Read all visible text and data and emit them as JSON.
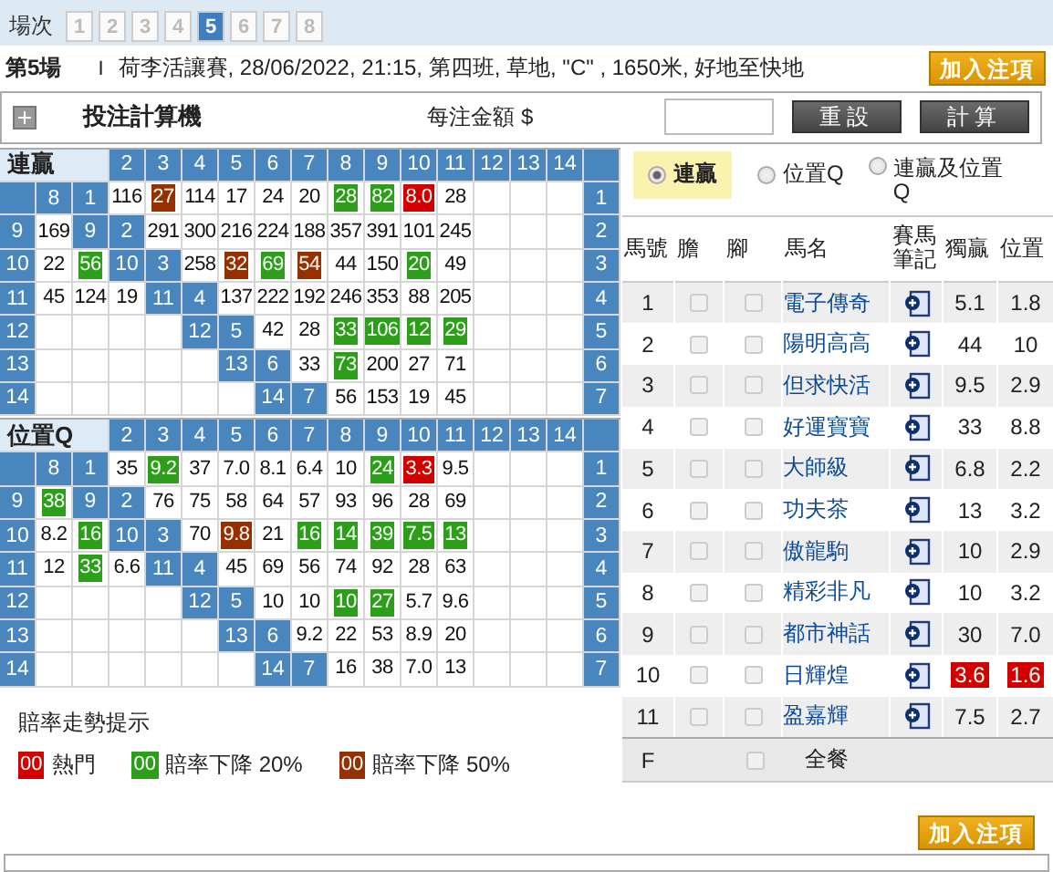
{
  "race_selector": {
    "label": "場次",
    "races": [
      {
        "label": "1",
        "selected": false
      },
      {
        "label": "2",
        "selected": false
      },
      {
        "label": "3",
        "selected": false
      },
      {
        "label": "4",
        "selected": false
      },
      {
        "label": "5",
        "selected": true
      },
      {
        "label": "6",
        "selected": false
      },
      {
        "label": "7",
        "selected": false
      },
      {
        "label": "8",
        "selected": false
      }
    ]
  },
  "race_header": {
    "number": "第5場",
    "separator": "I",
    "info": "荷李活讓賽, 28/06/2022, 21:15, 第四班, 草地, \"C\" , 1650米, 好地至快地",
    "add_button": "加入注項"
  },
  "calculator": {
    "title": "投注計算機",
    "amount_label": "每注金額 $",
    "buttons": [
      "重設",
      "計算"
    ]
  },
  "grids": [
    {
      "title": "連贏",
      "header": [
        "2",
        "3",
        "4",
        "5",
        "6",
        "7",
        "8",
        "9",
        "10",
        "11",
        "12",
        "13",
        "14"
      ],
      "rows": [
        [
          {
            "kind": "label"
          },
          {
            "kind": "label",
            "text": "8"
          },
          {
            "kind": "label",
            "text": "1"
          },
          {
            "kind": "odds",
            "text": "116"
          },
          {
            "kind": "drop50",
            "text": "27"
          },
          {
            "kind": "odds",
            "text": "114"
          },
          {
            "kind": "odds",
            "text": "17"
          },
          {
            "kind": "odds",
            "text": "24"
          },
          {
            "kind": "odds",
            "text": "20"
          },
          {
            "kind": "drop20",
            "text": "28"
          },
          {
            "kind": "drop20",
            "text": "82"
          },
          {
            "kind": "hot",
            "text": "8.0"
          },
          {
            "kind": "odds",
            "text": "28"
          },
          {
            "kind": "empty"
          },
          {
            "kind": "empty"
          },
          {
            "kind": "empty"
          },
          {
            "kind": "label",
            "text": "1"
          }
        ],
        [
          {
            "kind": "label",
            "text": "9"
          },
          {
            "kind": "odds",
            "text": "169"
          },
          {
            "kind": "label",
            "text": "9"
          },
          {
            "kind": "label",
            "text": "2"
          },
          {
            "kind": "odds",
            "text": "291"
          },
          {
            "kind": "odds",
            "text": "300"
          },
          {
            "kind": "odds",
            "text": "216"
          },
          {
            "kind": "odds",
            "text": "224"
          },
          {
            "kind": "odds",
            "text": "188"
          },
          {
            "kind": "odds",
            "text": "357"
          },
          {
            "kind": "odds",
            "text": "391"
          },
          {
            "kind": "odds",
            "text": "101"
          },
          {
            "kind": "odds",
            "text": "245"
          },
          {
            "kind": "empty"
          },
          {
            "kind": "empty"
          },
          {
            "kind": "empty"
          },
          {
            "kind": "label",
            "text": "2"
          }
        ],
        [
          {
            "kind": "label",
            "text": "10"
          },
          {
            "kind": "odds",
            "text": "22"
          },
          {
            "kind": "drop20",
            "text": "56"
          },
          {
            "kind": "label",
            "text": "10"
          },
          {
            "kind": "label",
            "text": "3"
          },
          {
            "kind": "odds",
            "text": "258"
          },
          {
            "kind": "drop50",
            "text": "32"
          },
          {
            "kind": "drop20",
            "text": "69"
          },
          {
            "kind": "drop50",
            "text": "54"
          },
          {
            "kind": "odds",
            "text": "44"
          },
          {
            "kind": "odds",
            "text": "150"
          },
          {
            "kind": "drop20",
            "text": "20"
          },
          {
            "kind": "odds",
            "text": "49"
          },
          {
            "kind": "empty"
          },
          {
            "kind": "empty"
          },
          {
            "kind": "empty"
          },
          {
            "kind": "label",
            "text": "3"
          }
        ],
        [
          {
            "kind": "label",
            "text": "11"
          },
          {
            "kind": "odds",
            "text": "45"
          },
          {
            "kind": "odds",
            "text": "124"
          },
          {
            "kind": "odds",
            "text": "19"
          },
          {
            "kind": "label",
            "text": "11"
          },
          {
            "kind": "label",
            "text": "4"
          },
          {
            "kind": "odds",
            "text": "137"
          },
          {
            "kind": "odds",
            "text": "222"
          },
          {
            "kind": "odds",
            "text": "192"
          },
          {
            "kind": "odds",
            "text": "246"
          },
          {
            "kind": "odds",
            "text": "353"
          },
          {
            "kind": "odds",
            "text": "88"
          },
          {
            "kind": "odds",
            "text": "205"
          },
          {
            "kind": "empty"
          },
          {
            "kind": "empty"
          },
          {
            "kind": "empty"
          },
          {
            "kind": "label",
            "text": "4"
          }
        ],
        [
          {
            "kind": "label",
            "text": "12"
          },
          {
            "kind": "empty"
          },
          {
            "kind": "empty"
          },
          {
            "kind": "empty"
          },
          {
            "kind": "empty"
          },
          {
            "kind": "label",
            "text": "12"
          },
          {
            "kind": "label",
            "text": "5"
          },
          {
            "kind": "odds",
            "text": "42"
          },
          {
            "kind": "odds",
            "text": "28"
          },
          {
            "kind": "drop20",
            "text": "33"
          },
          {
            "kind": "drop20",
            "text": "106"
          },
          {
            "kind": "drop20",
            "text": "12"
          },
          {
            "kind": "drop20",
            "text": "29"
          },
          {
            "kind": "empty"
          },
          {
            "kind": "empty"
          },
          {
            "kind": "empty"
          },
          {
            "kind": "label",
            "text": "5"
          }
        ],
        [
          {
            "kind": "label",
            "text": "13"
          },
          {
            "kind": "empty"
          },
          {
            "kind": "empty"
          },
          {
            "kind": "empty"
          },
          {
            "kind": "empty"
          },
          {
            "kind": "empty"
          },
          {
            "kind": "label",
            "text": "13"
          },
          {
            "kind": "label",
            "text": "6"
          },
          {
            "kind": "odds",
            "text": "33"
          },
          {
            "kind": "drop20",
            "text": "73"
          },
          {
            "kind": "odds",
            "text": "200"
          },
          {
            "kind": "odds",
            "text": "27"
          },
          {
            "kind": "odds",
            "text": "71"
          },
          {
            "kind": "empty"
          },
          {
            "kind": "empty"
          },
          {
            "kind": "empty"
          },
          {
            "kind": "label",
            "text": "6"
          }
        ],
        [
          {
            "kind": "label",
            "text": "14"
          },
          {
            "kind": "empty"
          },
          {
            "kind": "empty"
          },
          {
            "kind": "empty"
          },
          {
            "kind": "empty"
          },
          {
            "kind": "empty"
          },
          {
            "kind": "empty"
          },
          {
            "kind": "label",
            "text": "14"
          },
          {
            "kind": "label",
            "text": "7"
          },
          {
            "kind": "odds",
            "text": "56"
          },
          {
            "kind": "odds",
            "text": "153"
          },
          {
            "kind": "odds",
            "text": "19"
          },
          {
            "kind": "odds",
            "text": "45"
          },
          {
            "kind": "empty"
          },
          {
            "kind": "empty"
          },
          {
            "kind": "empty"
          },
          {
            "kind": "label",
            "text": "7"
          }
        ]
      ]
    },
    {
      "title": "位置Q",
      "header": [
        "2",
        "3",
        "4",
        "5",
        "6",
        "7",
        "8",
        "9",
        "10",
        "11",
        "12",
        "13",
        "14"
      ],
      "rows": [
        [
          {
            "kind": "label"
          },
          {
            "kind": "label",
            "text": "8"
          },
          {
            "kind": "label",
            "text": "1"
          },
          {
            "kind": "odds",
            "text": "35"
          },
          {
            "kind": "drop20",
            "text": "9.2"
          },
          {
            "kind": "odds",
            "text": "37"
          },
          {
            "kind": "odds",
            "text": "7.0"
          },
          {
            "kind": "odds",
            "text": "8.1"
          },
          {
            "kind": "odds",
            "text": "6.4"
          },
          {
            "kind": "odds",
            "text": "10"
          },
          {
            "kind": "drop20",
            "text": "24"
          },
          {
            "kind": "hot",
            "text": "3.3"
          },
          {
            "kind": "odds",
            "text": "9.5"
          },
          {
            "kind": "empty"
          },
          {
            "kind": "empty"
          },
          {
            "kind": "empty"
          },
          {
            "kind": "label",
            "text": "1"
          }
        ],
        [
          {
            "kind": "label",
            "text": "9"
          },
          {
            "kind": "drop20",
            "text": "38"
          },
          {
            "kind": "label",
            "text": "9"
          },
          {
            "kind": "label",
            "text": "2"
          },
          {
            "kind": "odds",
            "text": "76"
          },
          {
            "kind": "odds",
            "text": "75"
          },
          {
            "kind": "odds",
            "text": "58"
          },
          {
            "kind": "odds",
            "text": "64"
          },
          {
            "kind": "odds",
            "text": "57"
          },
          {
            "kind": "odds",
            "text": "93"
          },
          {
            "kind": "odds",
            "text": "96"
          },
          {
            "kind": "odds",
            "text": "28"
          },
          {
            "kind": "odds",
            "text": "69"
          },
          {
            "kind": "empty"
          },
          {
            "kind": "empty"
          },
          {
            "kind": "empty"
          },
          {
            "kind": "label",
            "text": "2"
          }
        ],
        [
          {
            "kind": "label",
            "text": "10"
          },
          {
            "kind": "odds",
            "text": "8.2"
          },
          {
            "kind": "drop20",
            "text": "16"
          },
          {
            "kind": "label",
            "text": "10"
          },
          {
            "kind": "label",
            "text": "3"
          },
          {
            "kind": "odds",
            "text": "70"
          },
          {
            "kind": "drop50",
            "text": "9.8"
          },
          {
            "kind": "odds",
            "text": "21"
          },
          {
            "kind": "drop20",
            "text": "16"
          },
          {
            "kind": "drop20",
            "text": "14"
          },
          {
            "kind": "drop20",
            "text": "39"
          },
          {
            "kind": "drop20",
            "text": "7.5"
          },
          {
            "kind": "drop20",
            "text": "13"
          },
          {
            "kind": "empty"
          },
          {
            "kind": "empty"
          },
          {
            "kind": "empty"
          },
          {
            "kind": "label",
            "text": "3"
          }
        ],
        [
          {
            "kind": "label",
            "text": "11"
          },
          {
            "kind": "odds",
            "text": "12"
          },
          {
            "kind": "drop20",
            "text": "33"
          },
          {
            "kind": "odds",
            "text": "6.6"
          },
          {
            "kind": "label",
            "text": "11"
          },
          {
            "kind": "label",
            "text": "4"
          },
          {
            "kind": "odds",
            "text": "45"
          },
          {
            "kind": "odds",
            "text": "69"
          },
          {
            "kind": "odds",
            "text": "56"
          },
          {
            "kind": "odds",
            "text": "74"
          },
          {
            "kind": "odds",
            "text": "92"
          },
          {
            "kind": "odds",
            "text": "28"
          },
          {
            "kind": "odds",
            "text": "63"
          },
          {
            "kind": "empty"
          },
          {
            "kind": "empty"
          },
          {
            "kind": "empty"
          },
          {
            "kind": "label",
            "text": "4"
          }
        ],
        [
          {
            "kind": "label",
            "text": "12"
          },
          {
            "kind": "empty"
          },
          {
            "kind": "empty"
          },
          {
            "kind": "empty"
          },
          {
            "kind": "empty"
          },
          {
            "kind": "label",
            "text": "12"
          },
          {
            "kind": "label",
            "text": "5"
          },
          {
            "kind": "odds",
            "text": "10"
          },
          {
            "kind": "odds",
            "text": "10"
          },
          {
            "kind": "drop20",
            "text": "10"
          },
          {
            "kind": "drop20",
            "text": "27"
          },
          {
            "kind": "odds",
            "text": "5.7"
          },
          {
            "kind": "odds",
            "text": "9.6"
          },
          {
            "kind": "empty"
          },
          {
            "kind": "empty"
          },
          {
            "kind": "empty"
          },
          {
            "kind": "label",
            "text": "5"
          }
        ],
        [
          {
            "kind": "label",
            "text": "13"
          },
          {
            "kind": "empty"
          },
          {
            "kind": "empty"
          },
          {
            "kind": "empty"
          },
          {
            "kind": "empty"
          },
          {
            "kind": "empty"
          },
          {
            "kind": "label",
            "text": "13"
          },
          {
            "kind": "label",
            "text": "6"
          },
          {
            "kind": "odds",
            "text": "9.2"
          },
          {
            "kind": "odds",
            "text": "22"
          },
          {
            "kind": "odds",
            "text": "53"
          },
          {
            "kind": "odds",
            "text": "8.9"
          },
          {
            "kind": "odds",
            "text": "20"
          },
          {
            "kind": "empty"
          },
          {
            "kind": "empty"
          },
          {
            "kind": "empty"
          },
          {
            "kind": "label",
            "text": "6"
          }
        ],
        [
          {
            "kind": "label",
            "text": "14"
          },
          {
            "kind": "empty"
          },
          {
            "kind": "empty"
          },
          {
            "kind": "empty"
          },
          {
            "kind": "empty"
          },
          {
            "kind": "empty"
          },
          {
            "kind": "empty"
          },
          {
            "kind": "label",
            "text": "14"
          },
          {
            "kind": "label",
            "text": "7"
          },
          {
            "kind": "odds",
            "text": "16"
          },
          {
            "kind": "odds",
            "text": "38"
          },
          {
            "kind": "odds",
            "text": "7.0"
          },
          {
            "kind": "odds",
            "text": "13"
          },
          {
            "kind": "empty"
          },
          {
            "kind": "empty"
          },
          {
            "kind": "empty"
          },
          {
            "kind": "label",
            "text": "7"
          }
        ]
      ]
    }
  ],
  "pool_options": [
    {
      "label": "連贏",
      "selected": true
    },
    {
      "label": "位置Q",
      "selected": false
    },
    {
      "label": "連贏及位置Q",
      "selected": false
    }
  ],
  "horse_table": {
    "columns": [
      "馬號",
      "膽",
      "腳",
      "馬名",
      "賽馬筆記",
      "獨贏",
      "位置"
    ],
    "rows": [
      {
        "number": "1",
        "banker": false,
        "leg": false,
        "name": "電子傳奇",
        "win": {
          "text": "5.1",
          "hot": false
        },
        "place": {
          "text": "1.8",
          "hot": false
        }
      },
      {
        "number": "2",
        "banker": false,
        "leg": false,
        "name": "陽明高高",
        "win": {
          "text": "44",
          "hot": false
        },
        "place": {
          "text": "10",
          "hot": false
        }
      },
      {
        "number": "3",
        "banker": false,
        "leg": false,
        "name": "但求快活",
        "win": {
          "text": "9.5",
          "hot": false
        },
        "place": {
          "text": "2.9",
          "hot": false
        }
      },
      {
        "number": "4",
        "banker": false,
        "leg": false,
        "name": "好運寶寶",
        "win": {
          "text": "33",
          "hot": false
        },
        "place": {
          "text": "8.8",
          "hot": false
        }
      },
      {
        "number": "5",
        "banker": false,
        "leg": false,
        "name": "大師級",
        "win": {
          "text": "6.8",
          "hot": false
        },
        "place": {
          "text": "2.2",
          "hot": false
        }
      },
      {
        "number": "6",
        "banker": false,
        "leg": false,
        "name": "功夫茶",
        "win": {
          "text": "13",
          "hot": false
        },
        "place": {
          "text": "3.2",
          "hot": false
        }
      },
      {
        "number": "7",
        "banker": false,
        "leg": false,
        "name": "傲龍駒",
        "win": {
          "text": "10",
          "hot": false
        },
        "place": {
          "text": "2.9",
          "hot": false
        }
      },
      {
        "number": "8",
        "banker": false,
        "leg": false,
        "name": "精彩非凡",
        "win": {
          "text": "10",
          "hot": false
        },
        "place": {
          "text": "3.2",
          "hot": false
        }
      },
      {
        "number": "9",
        "banker": false,
        "leg": false,
        "name": "都市神話",
        "win": {
          "text": "30",
          "hot": false
        },
        "place": {
          "text": "7.0",
          "hot": false
        }
      },
      {
        "number": "10",
        "banker": false,
        "leg": false,
        "name": "日輝煌",
        "win": {
          "text": "3.6",
          "hot": true
        },
        "place": {
          "text": "1.6",
          "hot": true
        }
      },
      {
        "number": "11",
        "banker": false,
        "leg": false,
        "name": "盈嘉輝",
        "win": {
          "text": "7.5",
          "hot": false
        },
        "place": {
          "text": "2.7",
          "hot": false
        }
      }
    ],
    "field_row": {
      "number": "F",
      "checked": false,
      "label": "全餐"
    }
  },
  "legend": {
    "title": "賠率走勢提示",
    "items": [
      {
        "kind": "hot",
        "swatch": "00",
        "label": "熱門"
      },
      {
        "kind": "drop20",
        "swatch": "00",
        "label": "賠率下降 20%"
      },
      {
        "kind": "drop50",
        "swatch": "00",
        "label": "賠率下降 50%"
      }
    ]
  },
  "bottom_add_button": "加入注項"
}
